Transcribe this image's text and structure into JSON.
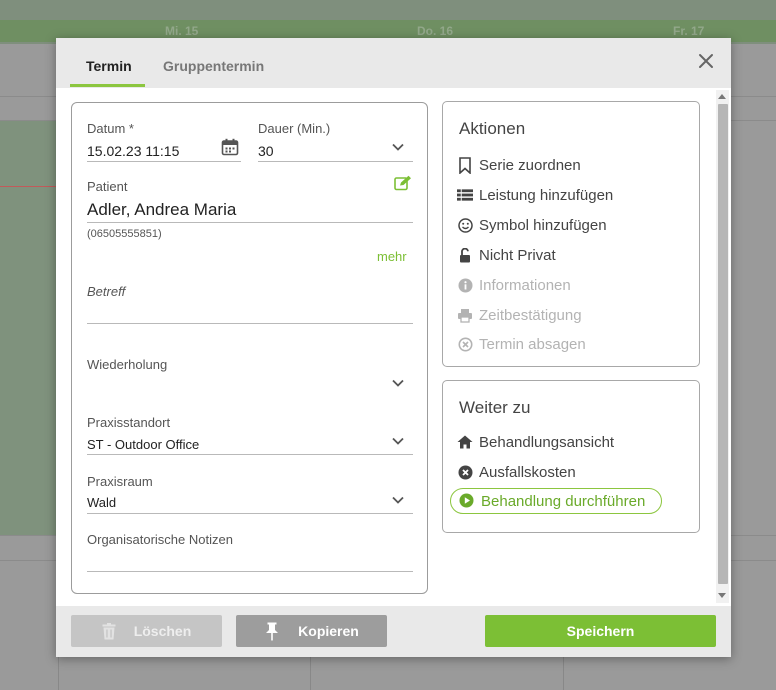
{
  "calendar": {
    "days": [
      "Mi. 15",
      "Do. 16",
      "Fr. 17"
    ]
  },
  "dialog": {
    "tabs": [
      {
        "label": "Termin",
        "active": true
      },
      {
        "label": "Gruppentermin",
        "active": false
      }
    ],
    "form": {
      "date_label": "Datum",
      "required_mark": "*",
      "date_value": "15.02.23 11:15",
      "duration_label": "Dauer (Min.)",
      "duration_value": "30",
      "patient_label": "Patient",
      "patient_name": "Adler, Andrea Maria",
      "patient_phone": "(06505555851)",
      "more_link": "mehr",
      "subject_placeholder": "Betreff",
      "repeat_label": "Wiederholung",
      "repeat_value": "",
      "location_label": "Praxisstandort",
      "location_value": "ST - Outdoor Office",
      "room_label": "Praxisraum",
      "room_value": "Wald",
      "notes_label": "Organisatorische Notizen",
      "notes_value": ""
    },
    "actions": {
      "title": "Aktionen",
      "items": [
        {
          "label": "Serie zuordnen",
          "icon": "bookmark-icon",
          "enabled": true
        },
        {
          "label": "Leistung hinzufügen",
          "icon": "list-icon",
          "enabled": true
        },
        {
          "label": "Symbol hinzufügen",
          "icon": "smiley-icon",
          "enabled": true
        },
        {
          "label": "Nicht Privat",
          "icon": "unlock-icon",
          "enabled": true
        },
        {
          "label": "Informationen",
          "icon": "info-icon",
          "enabled": false
        },
        {
          "label": "Zeitbestätigung",
          "icon": "printer-icon",
          "enabled": false
        },
        {
          "label": "Termin absagen",
          "icon": "cancel-circle-icon",
          "enabled": false
        }
      ]
    },
    "goto": {
      "title": "Weiter zu",
      "items": [
        {
          "label": "Behandlungsansicht",
          "icon": "home-icon"
        },
        {
          "label": "Ausfallskosten",
          "icon": "x-circle-icon"
        },
        {
          "label": "Behandlung durchführen",
          "icon": "play-circle-icon",
          "highlighted": true
        }
      ]
    },
    "footer": {
      "delete_label": "Löschen",
      "copy_label": "Kopieren",
      "save_label": "Speichern"
    },
    "colors": {
      "accent": "#8cc63f",
      "save_button": "#7cbf35",
      "disabled_button": "#c5c5c5",
      "copy_button": "#9d9d9d"
    }
  }
}
